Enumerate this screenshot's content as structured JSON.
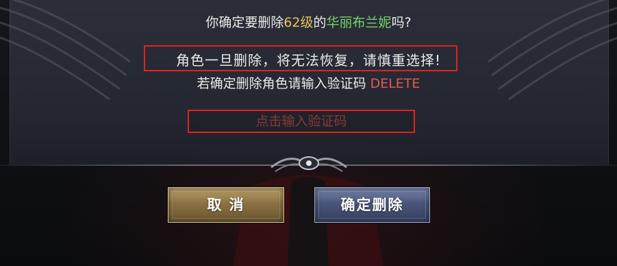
{
  "dialog": {
    "confirm_prefix": "你确定要删除",
    "level": "62级",
    "connector": "的",
    "character_name": "华丽布兰妮",
    "confirm_suffix": "吗?",
    "warning": "角色一旦删除，将无法恢复，请慎重选择!",
    "code_prompt": "若确定删除角色请输入验证码",
    "code": "DELETE"
  },
  "input": {
    "placeholder": "点击输入验证码"
  },
  "buttons": {
    "cancel": "取 消",
    "confirm": "确定删除"
  },
  "colors": {
    "level": "#e7c45c",
    "character_name": "#79d26b",
    "code": "#e35a52",
    "highlight_box": "#e3221f",
    "cancel_button": "#8b7243",
    "confirm_button": "#4a5679"
  },
  "icons": {
    "emblem": "winged-eye-emblem-icon",
    "wings": "feather-wing-icon"
  }
}
